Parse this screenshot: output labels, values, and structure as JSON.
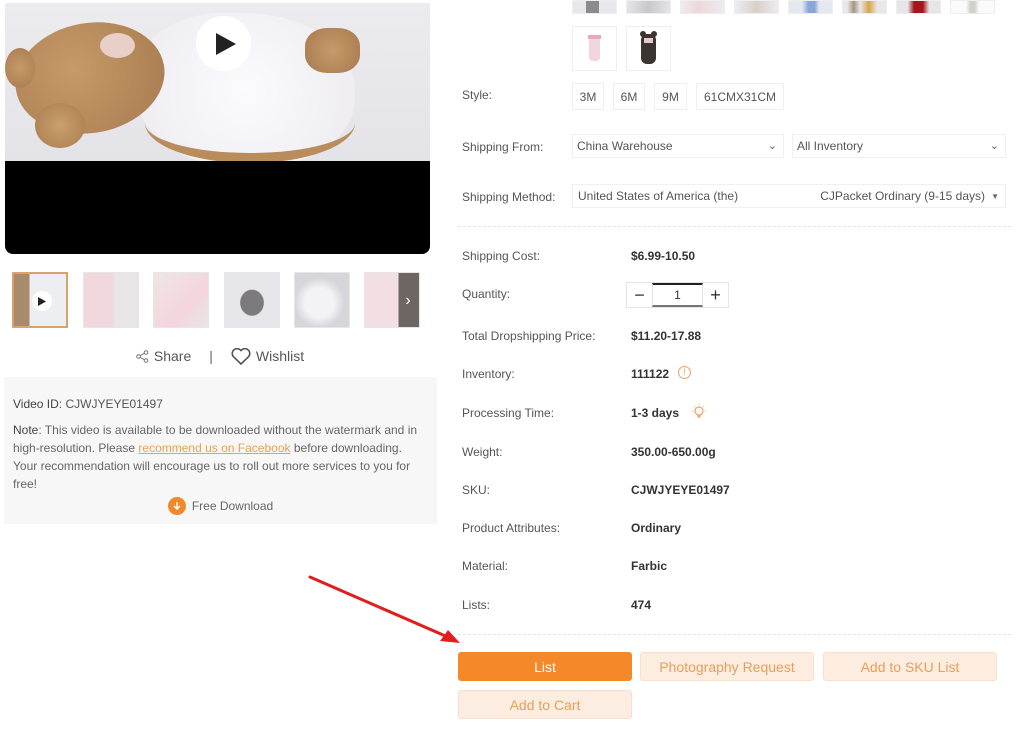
{
  "video": {
    "play_icon": "play-icon",
    "thumbnails": [
      {
        "label": "video thumbnail",
        "active": true,
        "has_play": true
      },
      {
        "label": "pink swaddle",
        "active": false
      },
      {
        "label": "pink baby",
        "active": false
      },
      {
        "label": "grey bear swaddle",
        "active": false
      },
      {
        "label": "white bear swaddle",
        "active": false
      },
      {
        "label": "pink swaddle with toy",
        "active": false
      }
    ],
    "next_icon": "chevron-right-icon"
  },
  "share": {
    "share_label": "Share",
    "separator": "|",
    "wishlist_label": "Wishlist"
  },
  "video_info": {
    "id_label": "Video ID:",
    "id_value": "CJWJYEYE01497",
    "note_label": "Note",
    "note_text_1": ": This video is available to be downloaded without the watermark and in high-resolution. Please ",
    "note_link": "recommend us on Facebook",
    "note_text_2": " before downloading. Your recommendation will encourage us to roll out more services to you for free!",
    "download_label": "Free Download"
  },
  "product": {
    "style": {
      "label": "Style:",
      "options": [
        "3M",
        "6M",
        "9M",
        "61CMX31CM"
      ]
    },
    "shipping_from": {
      "label": "Shipping From:",
      "warehouse": "China Warehouse",
      "inventory": "All Inventory"
    },
    "shipping_method": {
      "label": "Shipping Method:",
      "country": "United States of America (the)",
      "method": "CJPacket Ordinary (9-15 days)"
    },
    "shipping_cost": {
      "label": "Shipping Cost:",
      "value": "$6.99-10.50"
    },
    "quantity": {
      "label": "Quantity:",
      "value": "1",
      "minus": "−",
      "plus": "+"
    },
    "total_price": {
      "label": "Total Dropshipping Price:",
      "value": "$11.20-17.88"
    },
    "inventory": {
      "label": "Inventory:",
      "value": "111122",
      "icon": "!"
    },
    "processing_time": {
      "label": "Processing Time:",
      "value": "1-3 days"
    },
    "weight": {
      "label": "Weight:",
      "value": "350.00-650.00g"
    },
    "sku": {
      "label": "SKU:",
      "value": "CJWJYEYE01497"
    },
    "attributes": {
      "label": "Product Attributes:",
      "value": "Ordinary"
    },
    "material": {
      "label": "Material:",
      "value": "Farbic"
    },
    "lists": {
      "label": "Lists:",
      "value": "474"
    }
  },
  "actions": {
    "list": "List",
    "photography_request": "Photography Request",
    "add_to_sku_list": "Add to SKU List",
    "add_to_cart": "Add to Cart"
  },
  "colors": {
    "accent": "#f5892a",
    "accent_light": "#fdece0",
    "accent_text": "#e89f5a",
    "annotation_arrow": "#e01e1e"
  }
}
